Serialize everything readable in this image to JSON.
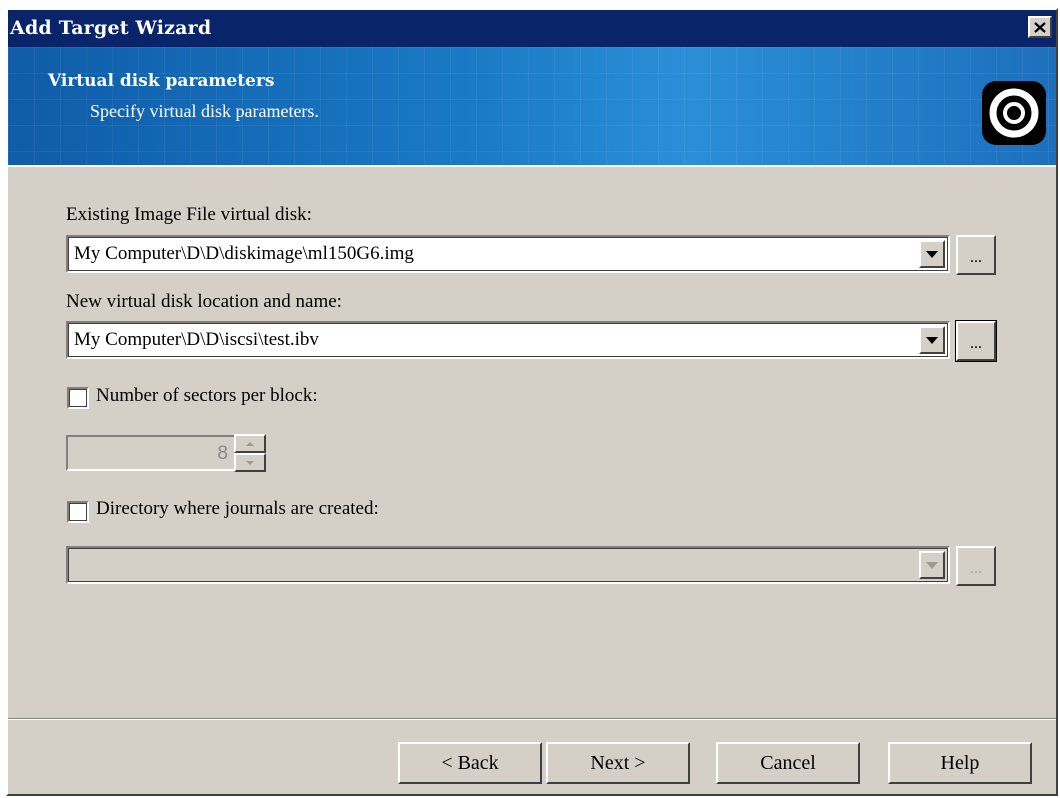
{
  "window": {
    "title": "Add Target Wizard"
  },
  "header": {
    "title": "Virtual disk parameters",
    "subtitle": "Specify virtual disk parameters.",
    "logo_icon": "disk-ring-icon"
  },
  "fields": {
    "existing_image": {
      "label": "Existing Image File virtual disk:",
      "value": "My Computer\\D\\D\\diskimage\\ml150G6.img",
      "browse_label": "..."
    },
    "new_disk": {
      "label": "New virtual disk location and name:",
      "value": "My Computer\\D\\D\\iscsi\\test.ibv",
      "browse_label": "..."
    },
    "sectors": {
      "label": "Number of sectors per block:",
      "checked": false,
      "value": "8"
    },
    "journals": {
      "label": "Directory where journals are created:",
      "checked": false,
      "value": "",
      "browse_label": "..."
    }
  },
  "buttons": {
    "back": "< Back",
    "next": "Next >",
    "cancel": "Cancel",
    "help": "Help"
  },
  "colors": {
    "titlebar": "#0a246a",
    "face": "#d4d0c8",
    "header_blue": "#1a7ac6"
  }
}
